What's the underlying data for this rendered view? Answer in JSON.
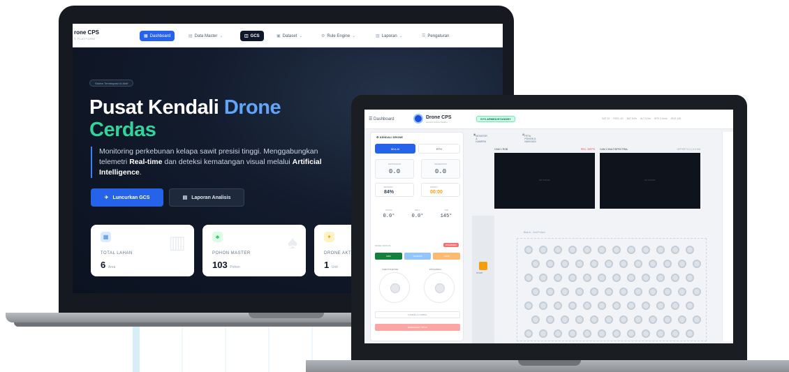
{
  "laptop1": {
    "brand": {
      "name": "rone CPS",
      "tagline": "S PLATFORM"
    },
    "nav": [
      {
        "label": "Dashboard",
        "state": "active"
      },
      {
        "label": "Data Master",
        "state": "normal"
      },
      {
        "label": "GCS",
        "state": "dark"
      },
      {
        "label": "Dataset",
        "state": "normal"
      },
      {
        "label": "Rule Engine",
        "state": "normal"
      },
      {
        "label": "Laporan",
        "state": "normal"
      },
      {
        "label": "Pengaturan",
        "state": "normal"
      }
    ],
    "badge": "Sistem Terintegrasi AI Aktif",
    "headline_white": "Pusat Kendali ",
    "headline_blue": "Drone",
    "headline_green": "Cerdas",
    "desc_part1": "Monitoring perkebunan kelapa sawit presisi tinggi. Menggabungkan telemetri ",
    "desc_bold1": "Real-time",
    "desc_part2": " dan deteksi kematangan visual melalui ",
    "desc_bold2": "Artificial Intelligence",
    "desc_end": ".",
    "btn_gcs": "Luncurkan GCS",
    "btn_report": "Laporan Analisis",
    "stats": [
      {
        "label": "TOTAL LAHAN",
        "value": "6",
        "unit": "Area",
        "color": "#3b82f6"
      },
      {
        "label": "POHON MASTER",
        "value": "103",
        "unit": "Pohon",
        "color": "#22c55e"
      },
      {
        "label": "DRONE AKT",
        "value": "1",
        "unit": "Unit",
        "color": "#f59e0b"
      }
    ]
  },
  "laptop2": {
    "nav": {
      "dashboard": "Dashboard",
      "brand": "Drone CPS",
      "brand_sub": "Ground Control Station",
      "system": "SYS ARMED/STANDBY",
      "telemetry": [
        "SAT 12",
        "RSSI -60",
        "BAT 84%",
        "ALT 0.0m",
        "SPD 0.0m/s",
        "HDG 145"
      ]
    },
    "panel": {
      "title": "KENDALI DRONE",
      "mode_on": "MULAI",
      "mode_off": "RTH",
      "alt_label": "KETINGGIAN",
      "alt_value": "0.0",
      "spd_label": "KECEPATAN",
      "spd_value": "0.0",
      "bat_label": "BATERAI",
      "bat_value": "84%",
      "time_label": "WAKTU",
      "time_value": "00:00",
      "attitude": [
        {
          "label": "PITCH",
          "value": "0.0°"
        },
        {
          "label": "ROLL",
          "value": "0.0°"
        },
        {
          "label": "YAW",
          "value": "145°"
        }
      ],
      "mode_text": "MODE: MANUAL",
      "status_tag": "DISARMED",
      "arm_buttons": [
        "ARM",
        "TAKEOFF",
        "LAND"
      ],
      "joy_left": "THROTTLE/YAW",
      "joy_right": "PITCH/ROLL",
      "bottom_btn": "KAMERA & GIMBAL",
      "emergency": "EMERGENCY STOP"
    },
    "tabs": [
      "MONITOR & KAMERA",
      "PETA POHON & NAVIGASI"
    ],
    "cams": [
      {
        "title": "CAM 1 RGB",
        "status": "REC. 30FPS",
        "screen": "NO SIGNAL"
      },
      {
        "title": "CAM 2 MULTISPECTRAL",
        "status": "OFFSET 0.0 | 0.0 KM",
        "screen": "NO SIGNAL"
      }
    ],
    "map_title": "Blok A - Grid Pohon",
    "side_label": "START"
  }
}
